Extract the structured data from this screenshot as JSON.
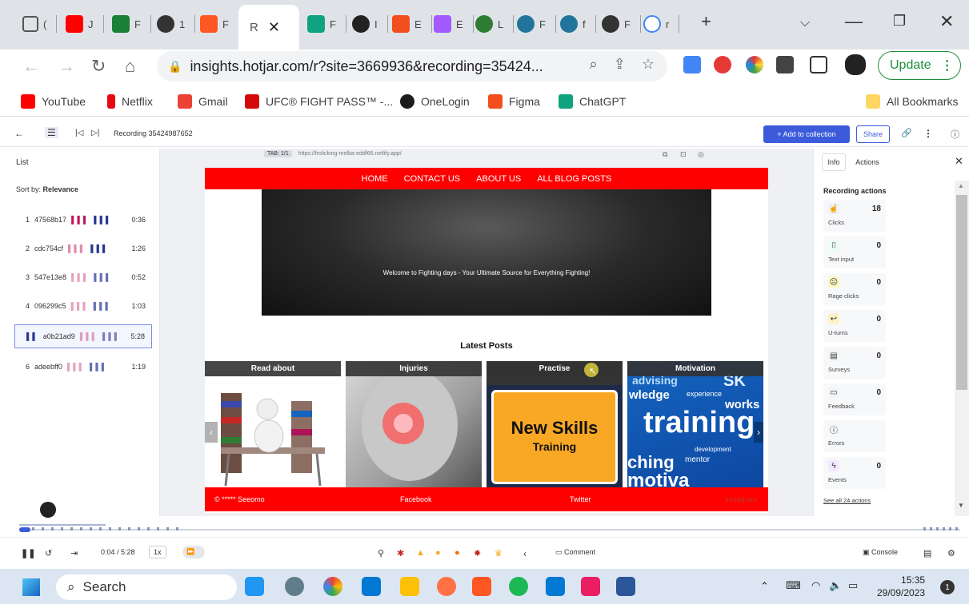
{
  "browser": {
    "active_tab_label": "R",
    "new_tab_symbol": "+",
    "url": "insights.hotjar.com/r?site=3669936&recording=35424...",
    "update_label": "Update"
  },
  "bookmarks": [
    {
      "label": "YouTube",
      "color": "#ff0000"
    },
    {
      "label": "Netflix",
      "color": "#e50914"
    },
    {
      "label": "Gmail",
      "color": "#ea4335"
    },
    {
      "label": "UFC® FIGHT PASS™ -...",
      "color": "#d20a0a"
    },
    {
      "label": "OneLogin",
      "color": "#1c1c1c"
    },
    {
      "label": "Figma",
      "color": "#f24e1e"
    },
    {
      "label": "ChatGPT",
      "color": "#10a37f"
    }
  ],
  "bookmarks_all": "All Bookmarks",
  "hotjar": {
    "recording_title": "Recording 35424987652",
    "add_to_collection": "+ Add to collection",
    "share": "Share"
  },
  "list": {
    "title": "List",
    "sort_prefix": "Sort by:",
    "sort_value": "Relevance",
    "items": [
      {
        "index": "1",
        "id": "47568b17",
        "duration": "0:36"
      },
      {
        "index": "2",
        "id": "cdc754cf",
        "duration": "1:26"
      },
      {
        "index": "3",
        "id": "547e13e8",
        "duration": "0:52"
      },
      {
        "index": "4",
        "id": "096299c5",
        "duration": "1:03"
      },
      {
        "index": "",
        "id": "a0b21ad9",
        "duration": "5:28"
      },
      {
        "index": "6",
        "id": "adeebff0",
        "duration": "1:19"
      }
    ]
  },
  "player": {
    "tab_badge": "TAB: 1/1",
    "page_url": "https://frolicking-melba-eddf66.netlify.app/"
  },
  "site": {
    "nav": [
      "HOME",
      "CONTACT US",
      "ABOUT US",
      "ALL BLOG POSTS"
    ],
    "hero_text": "Welcome to Fighting days - Your Ultimate Source for Everything Fighting!",
    "latest_posts": "Latest Posts",
    "cards": [
      "Read about",
      "Injuries",
      "Practise",
      "Motivation"
    ],
    "sign_line1": "New Skills",
    "sign_line2": "Training",
    "motivation_words": [
      "advising",
      "SK",
      "wledge",
      "experience",
      "works",
      "training",
      "development",
      "mentor",
      "ching",
      "motiva"
    ],
    "footer": {
      "copyright": "© ***** Seeomo",
      "facebook": "Facebook",
      "twitter": "Twitter",
      "instagram": "Instagram"
    }
  },
  "right_panel": {
    "tab_info": "Info",
    "tab_actions": "Actions",
    "heading": "Recording actions",
    "actions": [
      {
        "label": "Clicks",
        "count": "18",
        "icon": "click-icon",
        "color": "#eef2ff"
      },
      {
        "label": "Text input",
        "count": "0",
        "icon": "text-input-icon",
        "color": "#ecfdf5"
      },
      {
        "label": "Rage clicks",
        "count": "0",
        "icon": "rage-icon",
        "color": "#fef9c3"
      },
      {
        "label": "U-turns",
        "count": "0",
        "icon": "u-turn-icon",
        "color": "#fef3c7"
      },
      {
        "label": "Surveys",
        "count": "0",
        "icon": "survey-icon",
        "color": "#f3f4f6"
      },
      {
        "label": "Feedback",
        "count": "0",
        "icon": "feedback-icon",
        "color": "#f3f4f6"
      },
      {
        "label": "Errors",
        "count": "",
        "icon": "error-icon",
        "color": "#f3f4f6"
      },
      {
        "label": "Events",
        "count": "0",
        "icon": "events-icon",
        "color": "#f3e8ff"
      }
    ],
    "see_all": "See all 24 actions"
  },
  "controls": {
    "time": "0:04 / 5:28",
    "speed": "1x",
    "comment": "Comment",
    "console": "Console"
  },
  "taskbar": {
    "search": "Search",
    "time": "15:35",
    "date": "29/09/2023",
    "notifications": "1"
  }
}
